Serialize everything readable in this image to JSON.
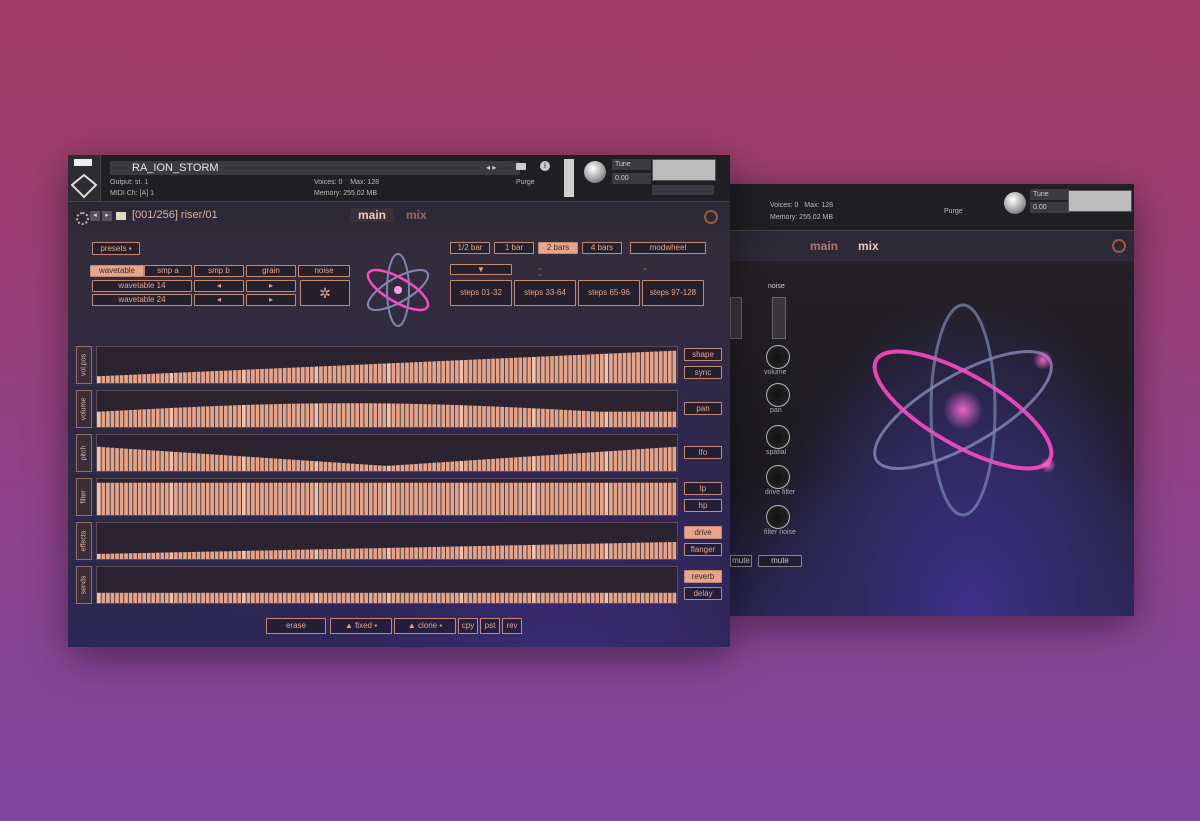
{
  "header": {
    "instrument_name": "RA_ION_STORM",
    "output_label": "Output:",
    "output_value": "st. 1",
    "midi_label": "MIDI Ch:",
    "midi_value": "[A] 1",
    "voices_label": "Voices:",
    "voices_value": "0",
    "max_label": "Max:",
    "max_value": "128",
    "memory_label": "Memory:",
    "memory_value": "255.02 MB",
    "purge_label": "Purge",
    "tune_label": "Tune",
    "tune_value": "0.00"
  },
  "nav": {
    "preset_path": "[001/256] riser/01",
    "tab_main": "main",
    "tab_mix": "mix"
  },
  "controls": {
    "presets_label": "presets",
    "source_tabs": [
      "wavetable",
      "smp a",
      "smp b",
      "grain",
      "noise"
    ],
    "wavetable_a": "wavetable 14",
    "wavetable_b": "wavetable 24",
    "length_buttons": [
      "1/2 bar",
      "1 bar",
      "2 bars",
      "4 bars",
      "modwheel"
    ],
    "active_length": "2 bars",
    "step_pages": [
      "steps 01-32",
      "steps 33-64",
      "steps 65-96",
      "steps 97-128"
    ]
  },
  "lanes": [
    {
      "label": "vol.pos",
      "buttons": [
        "shape",
        "sync"
      ]
    },
    {
      "label": "volume",
      "buttons": [
        "pan"
      ]
    },
    {
      "label": "pitch",
      "buttons": [
        "lfo"
      ]
    },
    {
      "label": "filter",
      "buttons": [
        "lp",
        "hp"
      ]
    },
    {
      "label": "effects",
      "buttons": [
        "drive",
        "flanger"
      ]
    },
    {
      "label": "sends",
      "buttons": [
        "reverb",
        "delay"
      ]
    }
  ],
  "footer": {
    "erase": "erase",
    "fixed": "fixed",
    "clone": "clone",
    "cpy": "cpy",
    "pst": "pst",
    "rev": "rev"
  },
  "mix_window": {
    "tab_main": "main",
    "tab_mix": "mix",
    "voices_value": "0",
    "max_value": "128",
    "memory_value": "255.02 MB",
    "tune_value": "0.00",
    "purge_label": "Purge",
    "noise_label": "noise",
    "knob_labels": [
      "volume",
      "pan",
      "spatial",
      "drive filter",
      "filter noise"
    ],
    "mute_a": "mute",
    "mute_b": "mute"
  }
}
